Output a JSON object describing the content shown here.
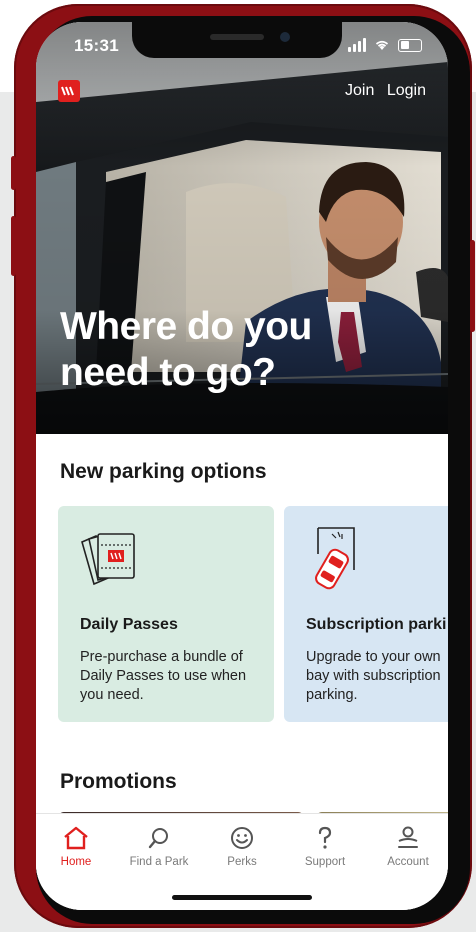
{
  "status_bar": {
    "time": "15:31"
  },
  "header": {
    "join": "Join",
    "login": "Login"
  },
  "hero": {
    "title": "Where do you need to go?"
  },
  "parking_section": {
    "title": "New parking options",
    "cards": [
      {
        "title": "Daily Passes",
        "description": "Pre-purchase a bundle of Daily Passes to use when you need.",
        "icon": "ticket-icon"
      },
      {
        "title": "Subscription parki",
        "description": "Upgrade to your own bay with subscription parking.",
        "icon": "car-bay-icon"
      }
    ]
  },
  "promotions": {
    "title": "Promotions"
  },
  "tabbar": {
    "items": [
      {
        "label": "Home",
        "icon": "home-icon",
        "active": true
      },
      {
        "label": "Find a Park",
        "icon": "search-icon",
        "active": false
      },
      {
        "label": "Perks",
        "icon": "smile-icon",
        "active": false
      },
      {
        "label": "Support",
        "icon": "question-icon",
        "active": false
      },
      {
        "label": "Account",
        "icon": "account-icon",
        "active": false
      }
    ]
  },
  "colors": {
    "brand_red": "#e0201e",
    "phone_frame": "#8c0f14",
    "card_green": "#d9ece2",
    "card_blue": "#d7e6f3"
  }
}
